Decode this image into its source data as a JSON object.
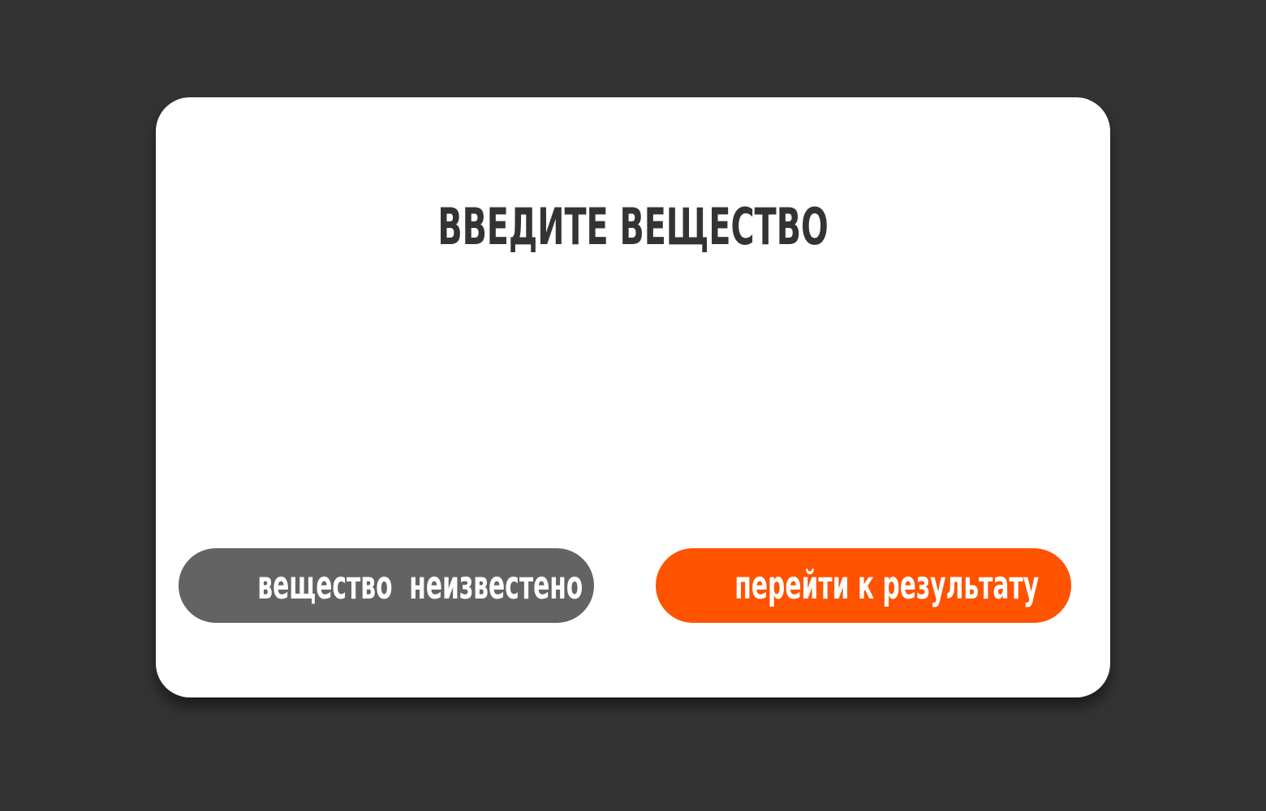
{
  "dialog": {
    "title": "ВВЕДИТЕ ВЕЩЕСТВО",
    "unknown_button_label": "вещество  неизвестено",
    "result_button_label": "перейти к результату"
  },
  "colors": {
    "background": "#333333",
    "dialog": "#ffffff",
    "title_text": "#333333",
    "unknown_button": "#636363",
    "result_button": "#ff5300",
    "button_text": "#ffffff"
  }
}
